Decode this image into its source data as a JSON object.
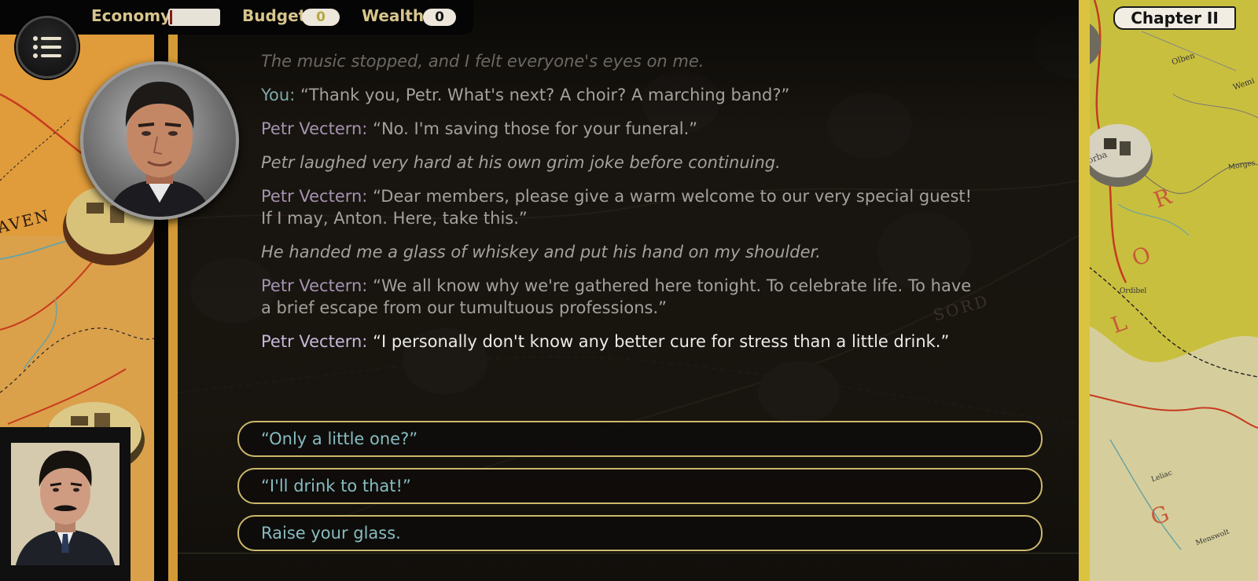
{
  "topbar": {
    "economy_label": "Economy",
    "economy_level": 0.05,
    "budget_label": "Budget",
    "budget_value": "0",
    "wealth_label": "Wealth",
    "wealth_value": "0"
  },
  "chapter": "Chapter II",
  "menu": {
    "icon": "list-menu-icon"
  },
  "map_left": {
    "labels": [
      "AVEN"
    ]
  },
  "map_right": {
    "labels": [
      "Olben",
      "Wemi",
      "Morba",
      "Morges",
      "Ordibel",
      "Leliac",
      "Menswolt",
      "L",
      "O",
      "R",
      "G"
    ]
  },
  "map_center": {
    "labels": [
      "SORD"
    ]
  },
  "dialogue": {
    "lines": [
      {
        "text": "drunk. He made an elaborate mock-curtsy as I passed him and walked into the room. The music stopped, and I felt everyone's eyes on me."
      },
      {
        "speaker": "You:",
        "text": "“Thank you, Petr. What's next? A choir? A marching band?”"
      },
      {
        "speaker": "Petr Vectern:",
        "text": "“No. I'm saving those for your funeral.”"
      },
      {
        "text": "Petr laughed very hard at his own grim joke before continuing."
      },
      {
        "speaker": "Petr Vectern:",
        "text": "“Dear members, please give a warm welcome to our very special guest! If I may, Anton. Here, take this.”"
      },
      {
        "text": "He handed me a glass of whiskey and put his hand on my shoulder."
      },
      {
        "speaker": "Petr Vectern:",
        "text": "“We all know why we're gathered here tonight. To celebrate life. To have a brief escape from our tumultuous professions.”"
      },
      {
        "speaker": "Petr Vectern:",
        "text": "“I personally don't know any better cure for stress than a little drink.”"
      }
    ]
  },
  "choices": [
    "“Only a little one?”",
    "“I'll drink to that!”",
    "Raise your glass."
  ],
  "colors": {
    "speaker_you": "#7fa8a8",
    "speaker_petr": "#a493b0",
    "choice_text": "#86bcc0",
    "choice_border": "#cbb86a"
  }
}
